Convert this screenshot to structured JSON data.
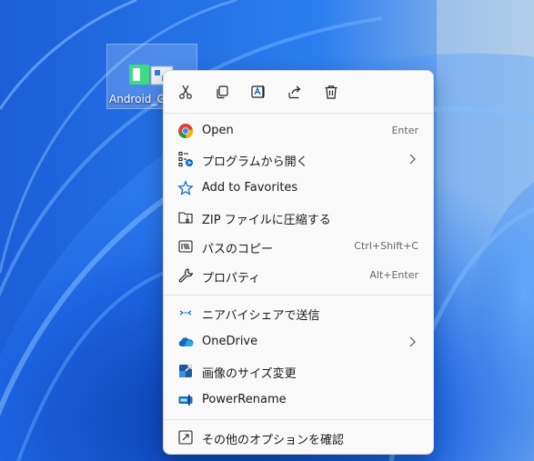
{
  "desktop": {
    "file_name": "Android_Gl"
  },
  "context_menu": {
    "quick_actions": [
      {
        "name": "cut-icon"
      },
      {
        "name": "copy-icon"
      },
      {
        "name": "rename-icon"
      },
      {
        "name": "share-icon"
      },
      {
        "name": "delete-icon"
      }
    ],
    "items": [
      {
        "label": "Open",
        "shortcut": "Enter",
        "icon": "chrome-icon"
      },
      {
        "label": "プログラムから開く",
        "submenu": true,
        "icon": "open-with-icon"
      },
      {
        "label": "Add to Favorites",
        "icon": "star-icon"
      },
      {
        "label": "ZIP ファイルに圧縮する",
        "icon": "zip-icon"
      },
      {
        "label": "パスのコピー",
        "shortcut": "Ctrl+Shift+C",
        "icon": "copy-path-icon"
      },
      {
        "label": "プロパティ",
        "shortcut": "Alt+Enter",
        "icon": "wrench-icon"
      },
      {
        "label": "ニアバイシェアで送信",
        "icon": "nearby-share-icon"
      },
      {
        "label": "OneDrive",
        "submenu": true,
        "icon": "onedrive-icon"
      },
      {
        "label": "画像のサイズ変更",
        "icon": "image-resize-icon"
      },
      {
        "label": "PowerRename",
        "icon": "powerrename-icon"
      },
      {
        "label": "その他のオプションを確認",
        "icon": "more-options-icon"
      }
    ]
  },
  "colors": {
    "menu_bg": "#f9f9f9",
    "accent_blue": "#0067c0",
    "wallpaper_deep": "#0a3fa8",
    "wallpaper_light": "#2f8fff"
  }
}
